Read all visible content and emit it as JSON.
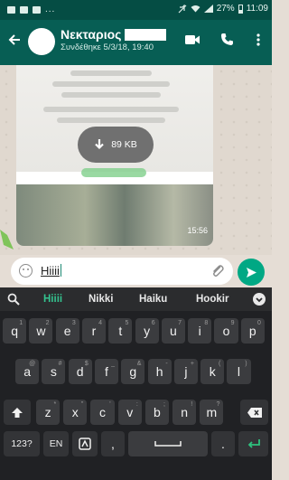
{
  "status_bar": {
    "right_text": "27%",
    "time": "11:09"
  },
  "chat_header": {
    "contact_name": "Νεκταριος",
    "last_seen": "Συνδέθηκε 5/3/18, 19:40"
  },
  "media_message": {
    "download_size": "89 KB",
    "time": "15:56"
  },
  "composer": {
    "text": "Hiiii"
  },
  "keyboard": {
    "suggestions": [
      "Hiiii",
      "Nikki",
      "Haiku",
      "Hookir"
    ],
    "row1": [
      "q",
      "w",
      "e",
      "r",
      "t",
      "y",
      "u",
      "i",
      "o",
      "p"
    ],
    "row1_hints": [
      "1",
      "2",
      "3",
      "4",
      "5",
      "6",
      "7",
      "8",
      "9",
      "0"
    ],
    "row2": [
      "a",
      "s",
      "d",
      "f",
      "g",
      "h",
      "j",
      "k",
      "l"
    ],
    "row2_hints": [
      "@",
      "#",
      "$",
      "_",
      "&",
      "-",
      "+",
      "(",
      ")"
    ],
    "row3": [
      "z",
      "x",
      "c",
      "v",
      "b",
      "n",
      "m"
    ],
    "row3_hints": [
      "*",
      "\"",
      "'",
      ":",
      ";",
      "!",
      "?"
    ],
    "symbols_key": "123?",
    "lang_key": "EN",
    "comma": ",",
    "period": "."
  },
  "colors": {
    "status_bar": "#054d44",
    "app_bar": "#075e54",
    "accent": "#00a884",
    "suggestion_highlight": "#34c38f",
    "keyboard_bg": "#202124",
    "key_bg": "#3b3c3f"
  },
  "icons": [
    "back-arrow-icon",
    "video-call-icon",
    "phone-icon",
    "more-vert-icon",
    "download-icon",
    "emoji-icon",
    "attach-icon",
    "send-icon",
    "search-icon",
    "chevron-down-icon",
    "shift-icon",
    "backspace-icon",
    "enter-icon",
    "sticker-icon"
  ]
}
